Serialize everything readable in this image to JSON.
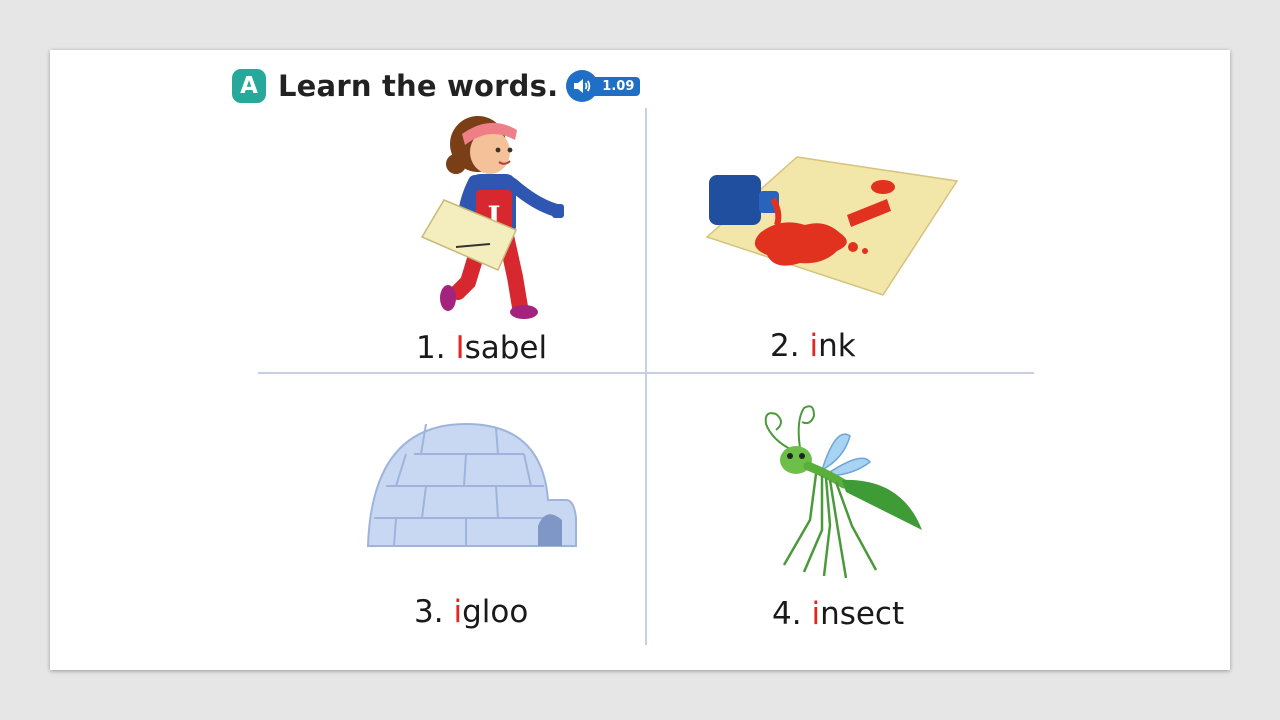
{
  "section": {
    "badge": "A",
    "title": "Learn the words.",
    "track": "1.09"
  },
  "words": [
    {
      "number": "1.",
      "initial": "I",
      "rest": "sabel",
      "icon": "girl-isabel-illustration"
    },
    {
      "number": "2.",
      "initial": "i",
      "rest": "nk",
      "icon": "ink-bottle-illustration"
    },
    {
      "number": "3.",
      "initial": "i",
      "rest": "gloo",
      "icon": "igloo-illustration"
    },
    {
      "number": "4.",
      "initial": "i",
      "rest": "nsect",
      "icon": "insect-illustration"
    }
  ],
  "colors": {
    "badge": "#27a89b",
    "audio": "#1f6fc6",
    "highlight": "#e0261e",
    "divider": "#c9cfe2"
  }
}
